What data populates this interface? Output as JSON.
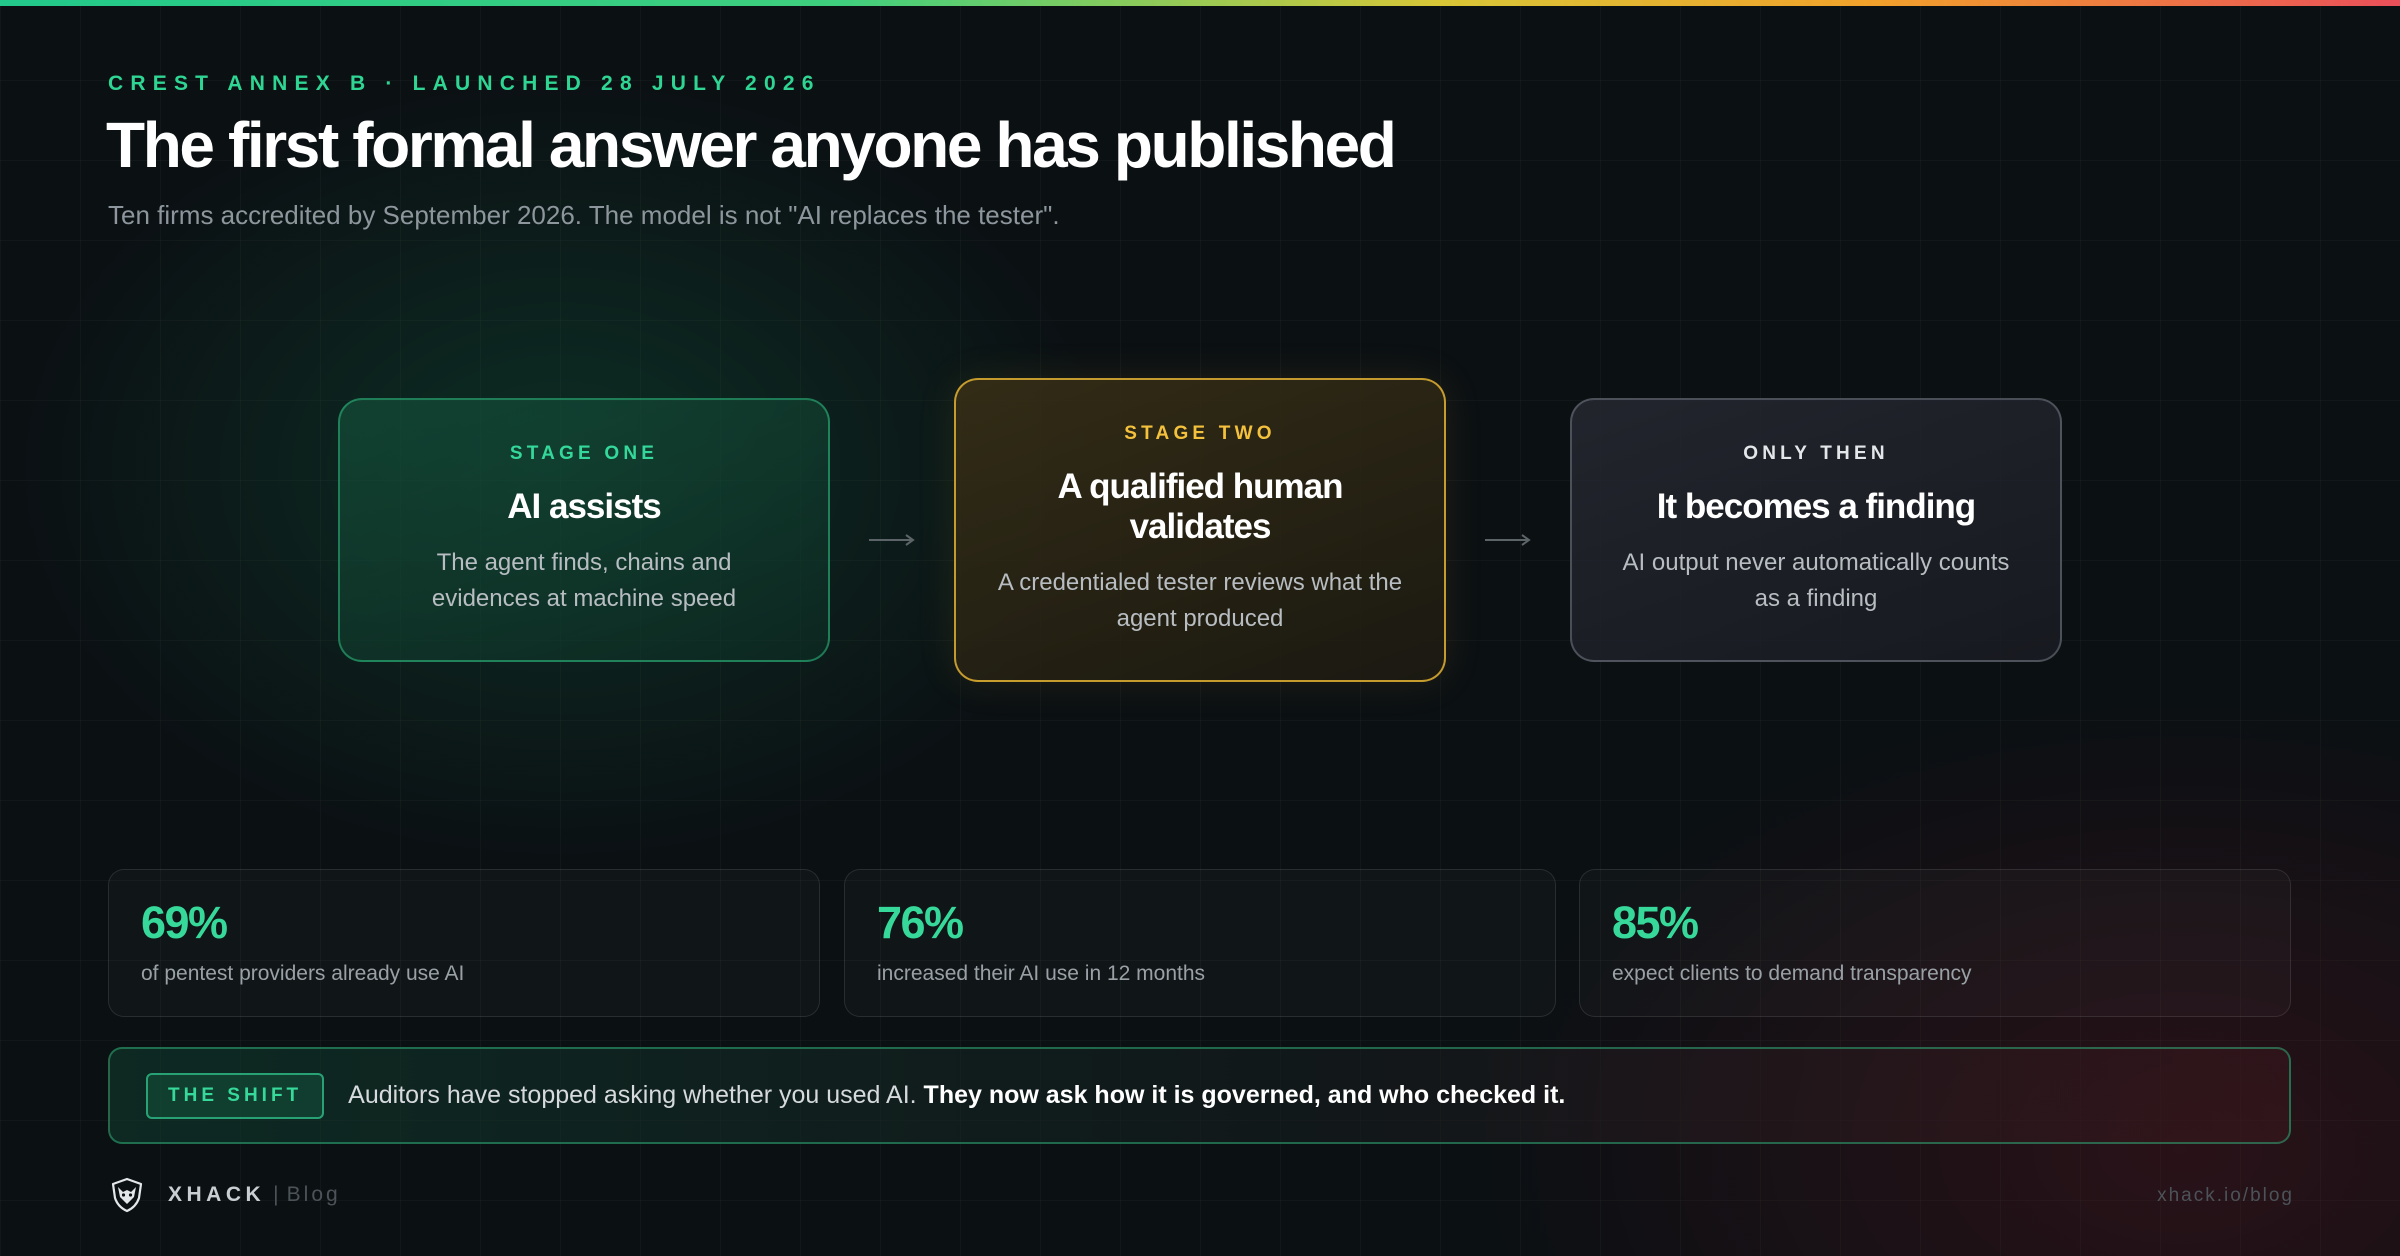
{
  "header": {
    "eyebrow": "CREST ANNEX B · LAUNCHED 28 JULY 2026",
    "title": "The first formal answer anyone has published",
    "subtitle": "Ten firms accredited by September 2026. The model is not \"AI replaces the tester\"."
  },
  "stages": [
    {
      "label": "STAGE ONE",
      "heading": "AI assists",
      "description": "The agent finds, chains and evidences at machine speed",
      "accent": "#34d89a"
    },
    {
      "label": "STAGE TWO",
      "heading": "A qualified human validates",
      "description": "A credentialed tester reviews what the agent produced",
      "accent": "#f4c13c"
    },
    {
      "label": "ONLY THEN",
      "heading": "It becomes a finding",
      "description": "AI output never automatically counts as a finding",
      "accent": "#e4e7ea"
    }
  ],
  "stats": [
    {
      "value": "69%",
      "label": "of pentest providers already use AI"
    },
    {
      "value": "76%",
      "label": "increased their AI use in 12 months"
    },
    {
      "value": "85%",
      "label": "expect clients to demand transparency"
    }
  ],
  "shift": {
    "badge": "THE SHIFT",
    "text": "Auditors have stopped asking whether you used AI.",
    "emphasis": "They now ask how it is governed, and who checked it."
  },
  "footer": {
    "logo_icon": "fox-shield-icon",
    "brand": "XHACK",
    "separator": "|",
    "section": "Blog",
    "url": "xhack.io/blog"
  },
  "colors": {
    "accent_green": "#2fd593",
    "accent_amber": "#f4c13c",
    "background": "#0b1013"
  }
}
